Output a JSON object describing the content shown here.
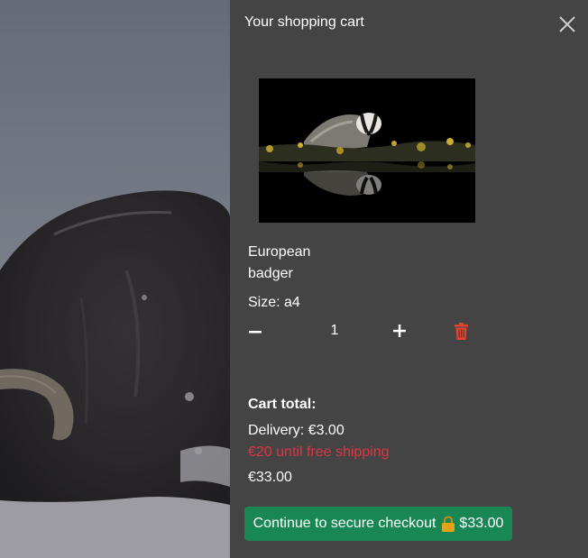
{
  "cart": {
    "title": "Your shopping cart",
    "close_icon": "close-icon"
  },
  "item": {
    "image_subject": "European badger photograph",
    "name": "European badger",
    "size": "Size: a4",
    "quantity": "1",
    "minus_icon": "minus-icon",
    "plus_icon": "plus-icon",
    "remove_icon": "trash-icon"
  },
  "summary": {
    "total_label": "Cart total:",
    "delivery": "Delivery: €3.00",
    "free_shipping_notice": "€20 until free shipping",
    "total": "€33.00"
  },
  "checkout": {
    "label": "Continue to secure checkout",
    "lock_icon": "lock-icon",
    "amount": "$33.00"
  },
  "colors": {
    "drawer_bg": "#444444",
    "checkout_green": "#198754",
    "notice_red": "#dc3545",
    "trash_red": "#e0442e",
    "lock_gold": "#e0a319"
  }
}
